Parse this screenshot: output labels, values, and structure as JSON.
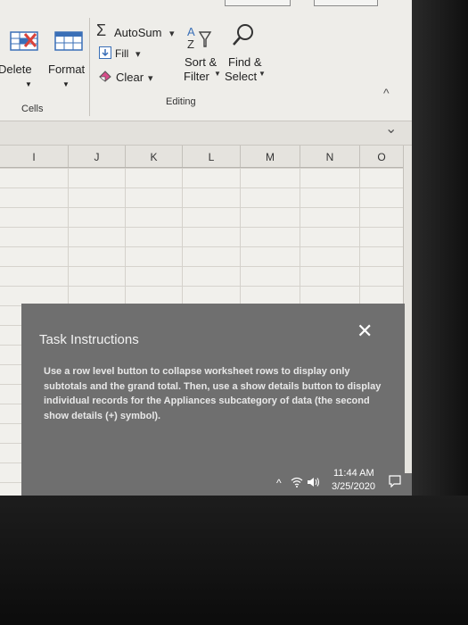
{
  "ribbon": {
    "autosum_label": "AutoSum",
    "autosum_arrow": "▾",
    "fill_label": "Fill",
    "fill_arrow": "▾",
    "clear_label": "Clear",
    "clear_arrow": "▾",
    "sort_filter_label_1": "Sort &",
    "sort_filter_label_2": "Filter",
    "find_select_label_1": "Find &",
    "find_select_label_2": "Select",
    "delete_label": "Delete",
    "format_label": "Format",
    "cells_group_label": "Cells",
    "editing_group_label": "Editing",
    "collapse_chevron": "^",
    "expand_chevron": "⌄"
  },
  "columns": [
    "I",
    "J",
    "K",
    "L",
    "M",
    "N",
    "O"
  ],
  "task": {
    "title": "Task Instructions",
    "close_glyph": "✕",
    "body": "Use a row level button to collapse worksheet rows to display only subtotals and the grand total. Then, use a show details button to display individual records for the Appliances subcategory of data (the second show details (+) symbol)."
  },
  "taskbar": {
    "time": "11:44 AM",
    "date": "3/25/2020",
    "tray_chevron": "^"
  },
  "icons": {
    "delete": "delete-cells-icon",
    "format": "format-cells-icon",
    "autosum": "sigma-icon",
    "fill": "fill-down-icon",
    "clear": "eraser-icon",
    "sort": "sort-filter-icon",
    "find": "magnifier-icon"
  },
  "colors": {
    "task_panel_bg": "#6f6f6f",
    "ribbon_bg": "#eeede9",
    "accent_blue": "#3a6fb7",
    "delete_red": "#d9433b"
  }
}
